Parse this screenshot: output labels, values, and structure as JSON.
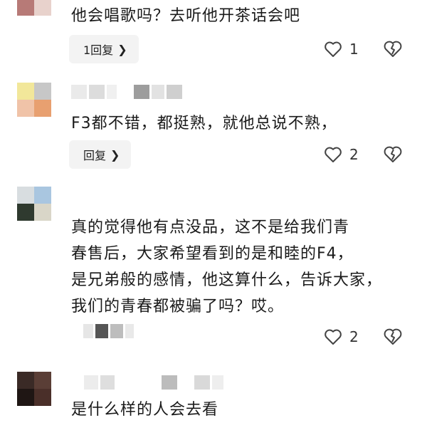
{
  "comments": [
    {
      "text": "他会唱歌吗？去听他开茶话会吧",
      "reply_label": "1回复",
      "like_count": "1"
    },
    {
      "text": "F3都不错，都挺熟，就他总说不熟，",
      "reply_label": "回复",
      "like_count": "2"
    },
    {
      "text": "真的觉得他有点没品，这不是给我们青\n春售后，大家希望看到的是和睦的F4，\n是兄弟般的感情，他这算什么，告诉大家，\n我们的青春都被骗了吗？哎。",
      "like_count": "2"
    },
    {
      "text": "是什么样的人会去看"
    }
  ],
  "icons": {
    "like": "heart-outline-icon",
    "dislike": "broken-heart-icon",
    "reply_chevron": "chevron-right-icon"
  },
  "colors": {
    "text": "#1a1a1a",
    "reply_bg": "#f3f3f3",
    "icon_stroke": "#444444"
  }
}
